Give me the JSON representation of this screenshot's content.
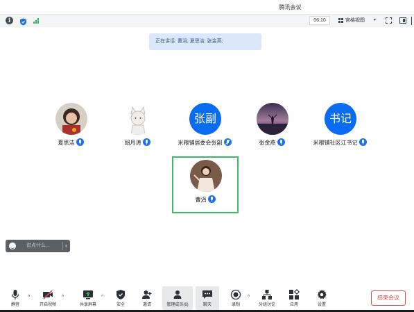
{
  "window": {
    "title": "腾讯会议"
  },
  "topbar": {
    "icons": [
      "info-icon",
      "shield-icon",
      "signal-icon"
    ],
    "timer": "06:10",
    "view_label": "宫格视图",
    "view_caret": "▾",
    "right_icons": [
      "fullscreen-icon",
      "layout-icon"
    ]
  },
  "speaker": {
    "prefix": "正在讲话: ",
    "names": "曹涓; 夏思洁; 张金燕;"
  },
  "participants": [
    {
      "name": "夏思洁",
      "avatar": "photo",
      "mic": "on"
    },
    {
      "name": "胡月涛",
      "avatar": "cartoon",
      "mic": "on"
    },
    {
      "name": "米粮铺居委会张副",
      "avatar_text": "张副",
      "mic": "off"
    },
    {
      "name": "张金燕",
      "avatar": "photo",
      "mic": "on"
    },
    {
      "name": "米粮铺社区江书记",
      "avatar_text": "书记",
      "mic": "on"
    },
    {
      "name": "曹涓",
      "avatar": "photo",
      "mic": "on",
      "active": true
    }
  ],
  "chat": {
    "placeholder": "说点什么...",
    "collapse": "‹"
  },
  "toolbar": {
    "caret": "^",
    "items": [
      {
        "label": "静音",
        "icon": "microphone-icon"
      },
      {
        "label": "开启视频",
        "icon": "video-off-icon"
      },
      {
        "label": "共享屏幕",
        "icon": "share-screen-icon"
      },
      {
        "label": "安全",
        "icon": "security-icon"
      },
      {
        "label": "邀请",
        "icon": "invite-icon"
      },
      {
        "label": "管理成员(6)",
        "icon": "members-icon"
      },
      {
        "label": "聊天",
        "icon": "chat-icon"
      },
      {
        "label": "录制",
        "icon": "record-icon"
      },
      {
        "label": "分组讨论",
        "icon": "breakout-icon"
      },
      {
        "label": "应用",
        "icon": "apps-icon"
      },
      {
        "label": "设置",
        "icon": "settings-icon"
      }
    ],
    "end_label": "结束会议"
  },
  "colors": {
    "accent": "#1a72f0",
    "active_border": "#3db669",
    "end": "#e24c4c",
    "speaker_bg": "#dbe8fb"
  }
}
